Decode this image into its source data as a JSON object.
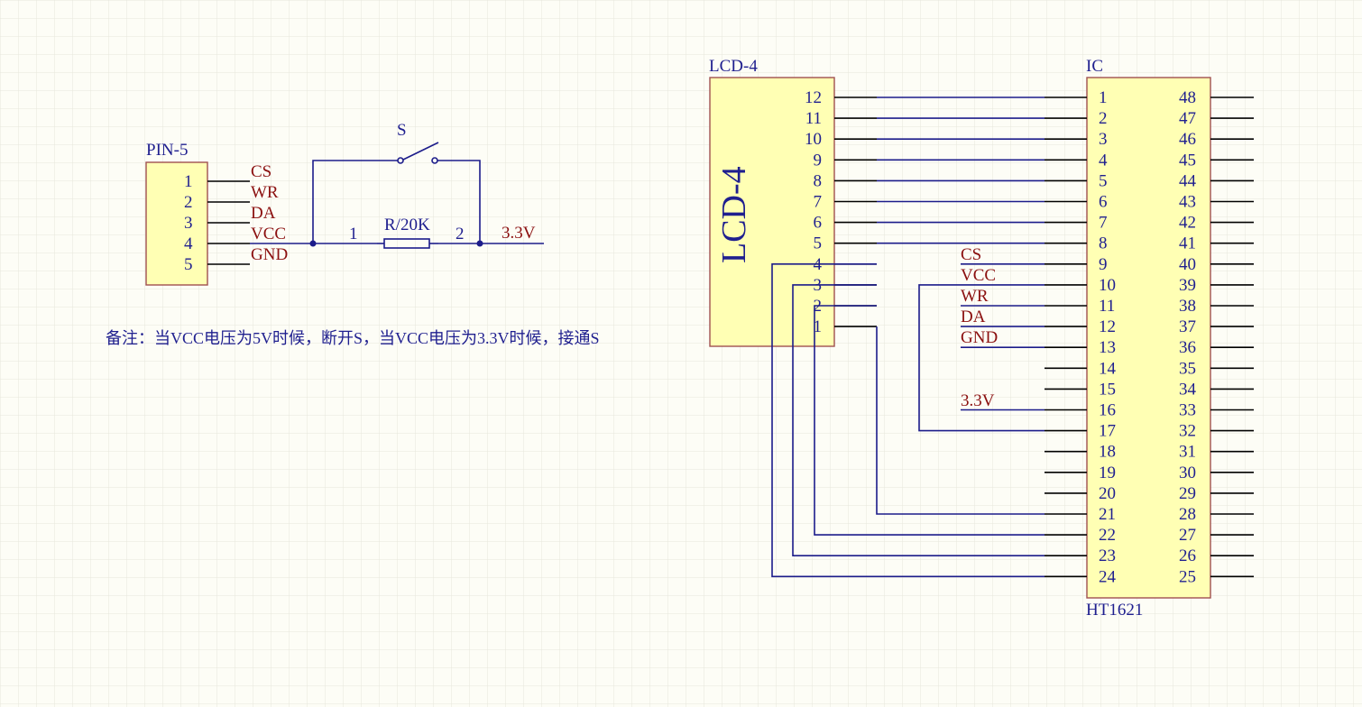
{
  "pin5": {
    "designator": "PIN-5",
    "pins": [
      "1",
      "2",
      "3",
      "4",
      "5"
    ],
    "nets": [
      "CS",
      "WR",
      "DA",
      "VCC",
      "GND"
    ]
  },
  "switch": {
    "label": "S"
  },
  "resistor": {
    "label": "R/20K",
    "pin1": "1",
    "pin2": "2"
  },
  "supply_label": "3.3V",
  "note": "备注：当VCC电压为5V时候，断开S，当VCC电压为3.3V时候，接通S",
  "lcd": {
    "designator": "LCD-4",
    "body_label": "LCD-4",
    "pins": [
      "12",
      "11",
      "10",
      "9",
      "8",
      "7",
      "6",
      "5",
      "4",
      "3",
      "2",
      "1"
    ]
  },
  "ic": {
    "designator": "IC",
    "part": "HT1621",
    "left_pins": [
      "1",
      "2",
      "3",
      "4",
      "5",
      "6",
      "7",
      "8",
      "9",
      "10",
      "11",
      "12",
      "13",
      "14",
      "15",
      "16",
      "17",
      "18",
      "19",
      "20",
      "21",
      "22",
      "23",
      "24"
    ],
    "right_pins": [
      "48",
      "47",
      "46",
      "45",
      "44",
      "43",
      "42",
      "41",
      "40",
      "39",
      "38",
      "37",
      "36",
      "35",
      "34",
      "33",
      "32",
      "31",
      "30",
      "29",
      "28",
      "27",
      "26",
      "25"
    ],
    "net_labels": [
      "CS",
      "VCC",
      "WR",
      "DA",
      "GND"
    ],
    "supply_label": "3.3V"
  },
  "colors": {
    "background": "#fdfdf6",
    "grid": "#e6e6dc",
    "wire": "#1c1c8a",
    "component_fill": "#ffffb4",
    "component_border": "#a05050",
    "net_label": "#8b1010",
    "designator": "#1f1f8f"
  }
}
